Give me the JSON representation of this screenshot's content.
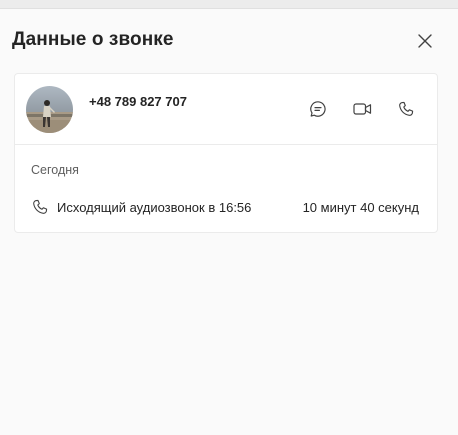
{
  "header": {
    "title": "Данные о звонке",
    "close_icon": "close-icon"
  },
  "contact": {
    "phone": "+48 789 827 707",
    "avatar": "contact-avatar-photo",
    "actions": {
      "chat_icon": "chat-icon",
      "video_icon": "video-call-icon",
      "call_icon": "phone-call-icon"
    }
  },
  "history": {
    "section_label": "Сегодня",
    "entries": [
      {
        "icon": "phone-icon",
        "description": "Исходящий аудиозвонок в 16:56",
        "duration": "10 минут 40 секунд"
      }
    ]
  },
  "colors": {
    "background": "#fafafa",
    "card": "#ffffff",
    "border": "#ebebeb",
    "text": "#242424",
    "muted_text": "#5f5f5f"
  }
}
